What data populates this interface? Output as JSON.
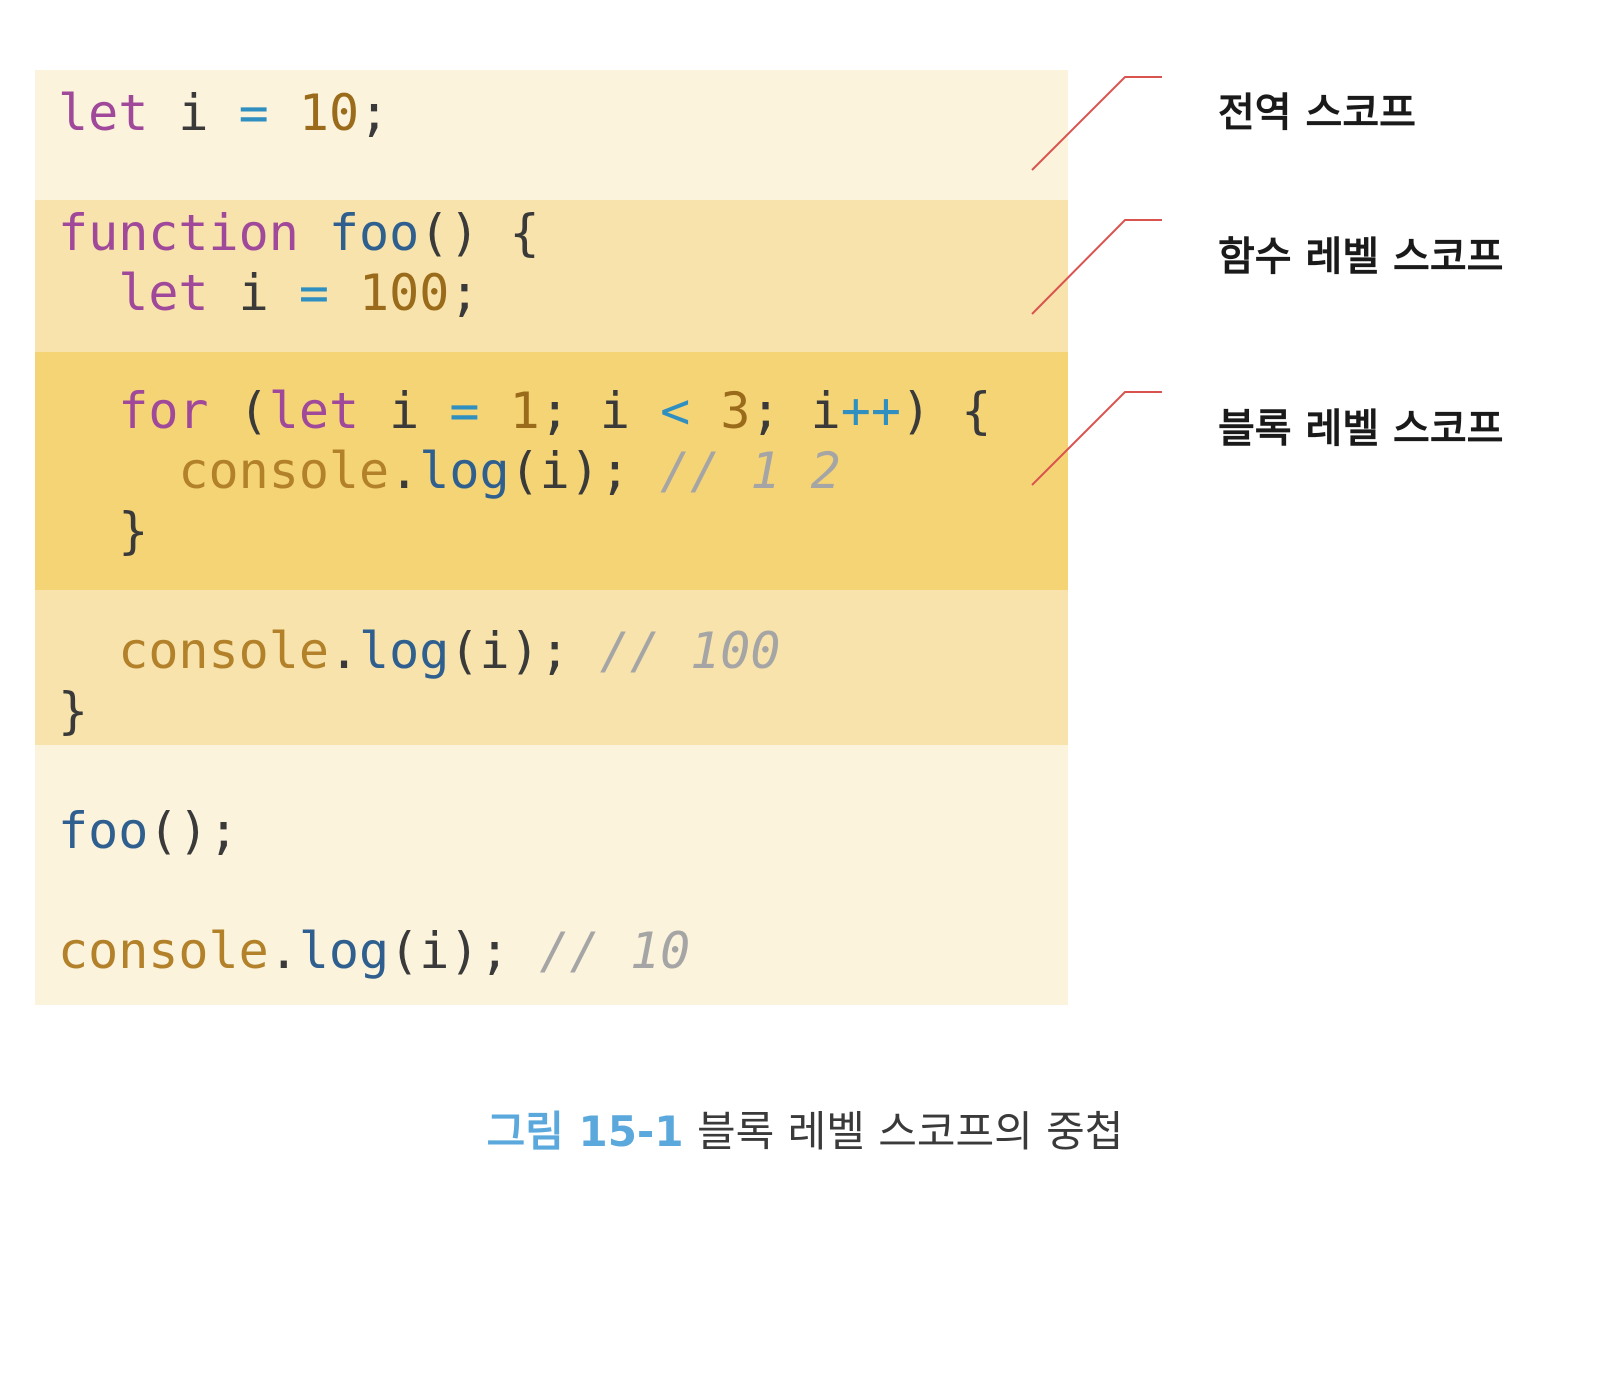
{
  "colors": {
    "global_scope_bg": "#fbf3dc",
    "function_scope_bg": "#f7e3ab",
    "block_scope_bg": "#f5d476",
    "keyword": "#a0499a",
    "function_name": "#2f5f8f",
    "number": "#9a6b1a",
    "operator": "#2f8fc0",
    "object": "#b2812a",
    "comment": "#a5a5a5",
    "leader_line": "#d9534f",
    "caption_number": "#5aa8dc"
  },
  "code": {
    "line1": {
      "kw": "let",
      "ident": " i ",
      "op": "=",
      "num": " 10",
      "end": ";"
    },
    "line2": {
      "kw": "function",
      "fn": " foo",
      "rest": "() {"
    },
    "line3": {
      "indent": "  ",
      "kw": "let",
      "ident": " i ",
      "op": "=",
      "num": " 100",
      "end": ";"
    },
    "line4": {
      "indent": "  ",
      "kw": "for",
      "p1": " (",
      "kw2": "let",
      "p2": " i ",
      "op1": "=",
      "num1": " 1",
      "p3": "; i ",
      "op2": "<",
      "num2": " 3",
      "p4": "; i",
      "op3": "++",
      "p5": ") {"
    },
    "line5": {
      "indent": "    ",
      "obj": "console",
      "dot": ".",
      "fn": "log",
      "args": "(i); ",
      "comment": "// 1 2"
    },
    "line6": {
      "text": "  }"
    },
    "line7": {
      "indent": "  ",
      "obj": "console",
      "dot": ".",
      "fn": "log",
      "args": "(i); ",
      "comment": "// 100"
    },
    "line8": {
      "text": "}"
    },
    "line9": {
      "fn": "foo",
      "rest": "();"
    },
    "line10": {
      "obj": "console",
      "dot": ".",
      "fn": "log",
      "args": "(i); ",
      "comment": "// 10"
    }
  },
  "labels": {
    "global": "전역 스코프",
    "function": "함수 레벨 스코프",
    "block": "블록 레벨 스코프"
  },
  "caption": {
    "number": "그림 15-1",
    "text": " 블록 레벨 스코프의 중첩"
  }
}
